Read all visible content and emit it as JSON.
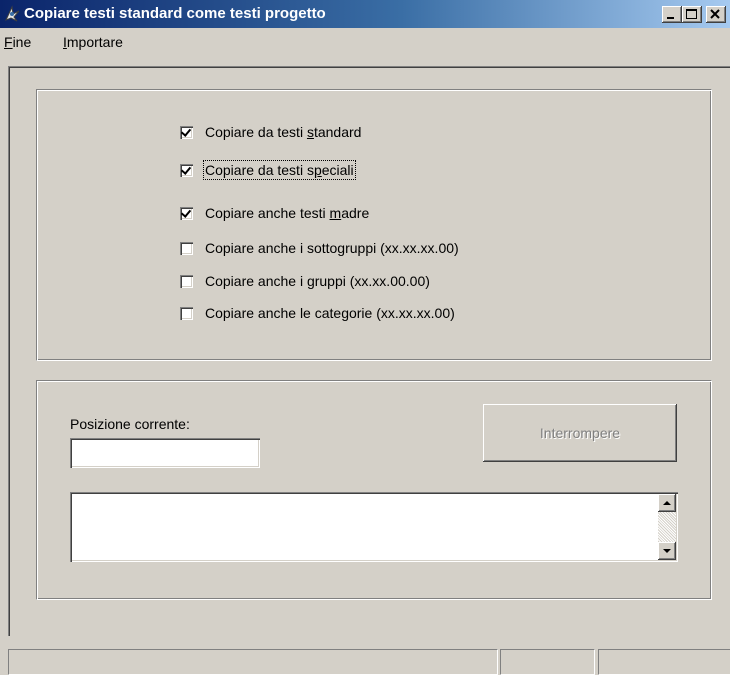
{
  "window": {
    "title": "Copiare testi standard come testi progetto",
    "caption_buttons": [
      "minimize",
      "maximize",
      "close"
    ]
  },
  "menu": [
    {
      "label": "Fine",
      "mnemonic": "F",
      "rest": "ine"
    },
    {
      "label": "Importare",
      "mnemonic": "I",
      "rest": "mportare"
    }
  ],
  "options": [
    {
      "label": "Copiare da testi standard",
      "pre": "Copiare da testi ",
      "mnemonic": "s",
      "post": "tandard",
      "checked": true,
      "focused": false
    },
    {
      "label": "Copiare da testi speciali",
      "pre": "Copiare da testi s",
      "mnemonic": "p",
      "post": "eciali",
      "checked": true,
      "focused": true
    },
    {
      "label": "Copiare anche testi madre",
      "pre": "Copiare anche testi ",
      "mnemonic": "m",
      "post": "adre",
      "checked": true,
      "focused": false
    },
    {
      "label": "Copiare anche i sottogruppi (xx.xx.xx.00)",
      "pre": "Copiare anche i sottogruppi (xx.xx.xx.00)",
      "mnemonic": "",
      "post": "",
      "checked": false,
      "focused": false
    },
    {
      "label": "Copiare anche i gruppi (xx.xx.00.00)",
      "pre": "Copiare anche i gruppi (xx.xx.00.00)",
      "mnemonic": "",
      "post": "",
      "checked": false,
      "focused": false
    },
    {
      "label": "Copiare anche le categorie (xx.xx.xx.00)",
      "pre": "Copiare anche le categorie (xx.xx.xx.00)",
      "mnemonic": "",
      "post": "",
      "checked": false,
      "focused": false
    }
  ],
  "progress": {
    "position_label": "Posizione corrente:",
    "position_value": "",
    "interrupt_label": "Interrompere",
    "interrupt_enabled": false,
    "log_text": ""
  },
  "statusbar": {
    "pane1": "",
    "pane2": "",
    "pane3": ""
  },
  "colors": {
    "face": "#d4d0c8",
    "title_start": "#0a246a",
    "title_end": "#a6caf0",
    "disabled_text": "#808080"
  },
  "icons": {
    "app": "app-icon",
    "checkmark": "checkmark-icon",
    "scroll_up": "arrow-up-icon",
    "scroll_down": "arrow-down-icon"
  }
}
